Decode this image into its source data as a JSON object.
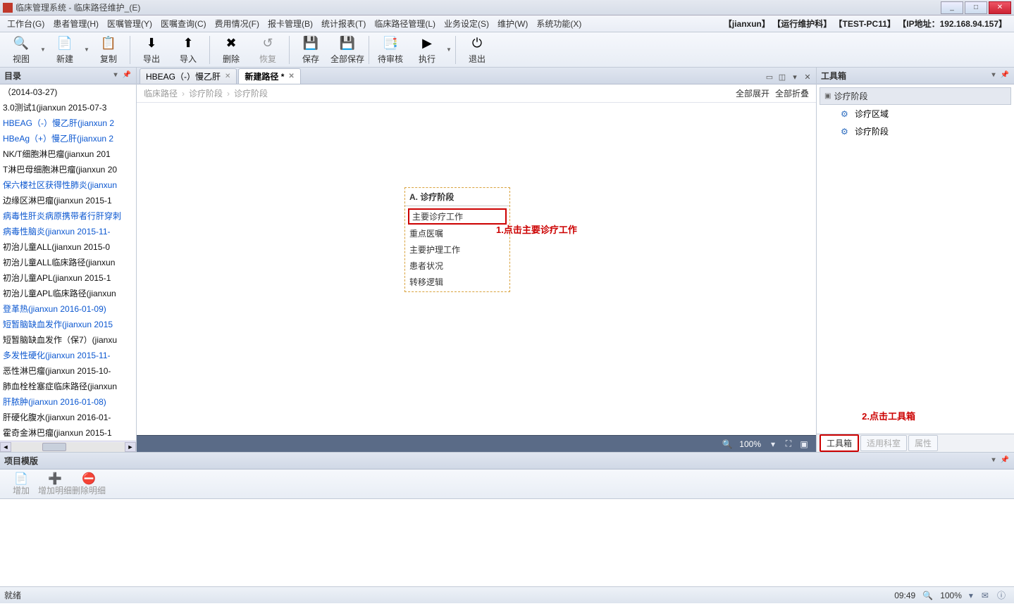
{
  "window": {
    "title": "临床管理系统 - 临床路径维护_(E)"
  },
  "menubar": {
    "items": [
      "工作台(G)",
      "患者管理(H)",
      "医嘱管理(Y)",
      "医嘱查询(C)",
      "费用情况(F)",
      "报卡管理(B)",
      "统计报表(T)",
      "临床路径管理(L)",
      "业务设定(S)",
      "维护(W)",
      "系统功能(X)"
    ],
    "rightinfo": "【jianxun】 【运行维护科】 【TEST-PC11】 【IP地址：192.168.94.157】"
  },
  "toolbar": {
    "items": [
      {
        "label": "视图",
        "icon": "🔍",
        "dropdown": true
      },
      {
        "label": "新建",
        "icon": "📄",
        "dropdown": true
      },
      {
        "label": "复制",
        "icon": "📋"
      },
      {
        "sep": true
      },
      {
        "label": "导出",
        "icon": "⬇"
      },
      {
        "label": "导入",
        "icon": "⬆"
      },
      {
        "sep": true
      },
      {
        "label": "删除",
        "icon": "✖"
      },
      {
        "label": "恢复",
        "icon": "↺",
        "disabled": true
      },
      {
        "sep": true
      },
      {
        "label": "保存",
        "icon": "💾"
      },
      {
        "label": "全部保存",
        "icon": "💾"
      },
      {
        "sep": true
      },
      {
        "label": "待审核",
        "icon": "📑"
      },
      {
        "label": "执行",
        "icon": "▶",
        "dropdown": true
      },
      {
        "sep": true
      },
      {
        "label": "退出",
        "icon": "⏻"
      }
    ]
  },
  "directory": {
    "title": "目录",
    "items": [
      {
        "text": "（2014-03-27)",
        "blue": false
      },
      {
        "text": "3.0测试1(jianxun  2015-07-3",
        "blue": false
      },
      {
        "text": "HBEAG（-）慢乙肝(jianxun  2",
        "blue": true
      },
      {
        "text": "HBeAg（+）慢乙肝(jianxun  2",
        "blue": true
      },
      {
        "text": "NK/T细胞淋巴瘤(jianxun  201",
        "blue": false
      },
      {
        "text": "T淋巴母细胞淋巴瘤(jianxun  20",
        "blue": false
      },
      {
        "text": "保六楼社区获得性肺炎(jianxun",
        "blue": true
      },
      {
        "text": "边缘区淋巴瘤(jianxun  2015-1",
        "blue": false
      },
      {
        "text": "病毒性肝炎病原携带者行肝穿刺",
        "blue": true
      },
      {
        "text": "病毒性脑炎(jianxun  2015-11-",
        "blue": true
      },
      {
        "text": "初治儿童ALL(jianxun  2015-0",
        "blue": false
      },
      {
        "text": "初治儿童ALL临床路径(jianxun",
        "blue": false
      },
      {
        "text": "初治儿童APL(jianxun  2015-1",
        "blue": false
      },
      {
        "text": "初治儿童APL临床路径(jianxun",
        "blue": false
      },
      {
        "text": "登革热(jianxun  2016-01-09)",
        "blue": true
      },
      {
        "text": "短暂脑缺血发作(jianxun  2015",
        "blue": true
      },
      {
        "text": "短暂脑缺血发作（保7）(jianxu",
        "blue": false
      },
      {
        "text": "多发性硬化(jianxun  2015-11-",
        "blue": true
      },
      {
        "text": "恶性淋巴瘤(jianxun  2015-10-",
        "blue": false
      },
      {
        "text": "肺血栓栓塞症临床路径(jianxun",
        "blue": false
      },
      {
        "text": "肝脓肿(jianxun  2016-01-08)",
        "blue": true
      },
      {
        "text": "肝硬化腹水(jianxun  2016-01-",
        "blue": false
      },
      {
        "text": "霍奇金淋巴瘤(jianxun  2015-1",
        "blue": false
      }
    ]
  },
  "tabs": {
    "items": [
      {
        "label": "HBEAG（-）慢乙肝",
        "active": false
      },
      {
        "label": "新建路径 *",
        "active": true
      }
    ]
  },
  "breadcrumb": {
    "items": [
      "临床路径",
      "诊疗阶段",
      "诊疗阶段"
    ],
    "expand": "全部展开",
    "collapse": "全部折叠"
  },
  "stage": {
    "title": "A. 诊疗阶段",
    "items": [
      {
        "label": "主要诊疗工作",
        "hl": true
      },
      {
        "label": "重点医嘱"
      },
      {
        "label": "主要护理工作"
      },
      {
        "label": "患者状况"
      },
      {
        "label": "转移逻辑"
      }
    ]
  },
  "annotations": {
    "a1": "1.点击主要诊疗工作",
    "a2": "2.点击工具箱"
  },
  "canvasfooter": {
    "zoom": "100%"
  },
  "toolbox": {
    "title": "工具箱",
    "section": "诊疗阶段",
    "items": [
      "诊疗区域",
      "诊疗阶段"
    ],
    "tabs": [
      {
        "label": "工具箱",
        "state": "active"
      },
      {
        "label": "适用科室",
        "state": "disabled"
      },
      {
        "label": "属性",
        "state": "disabled"
      }
    ]
  },
  "template": {
    "title": "项目模版",
    "btns": [
      {
        "label": "增加",
        "icon": "📄"
      },
      {
        "label": "增加明细",
        "icon": "➕"
      },
      {
        "label": "删除明细",
        "icon": "⛔"
      }
    ]
  },
  "statusbar": {
    "ready": "就绪",
    "time": "09:49",
    "zoom": "100%"
  }
}
